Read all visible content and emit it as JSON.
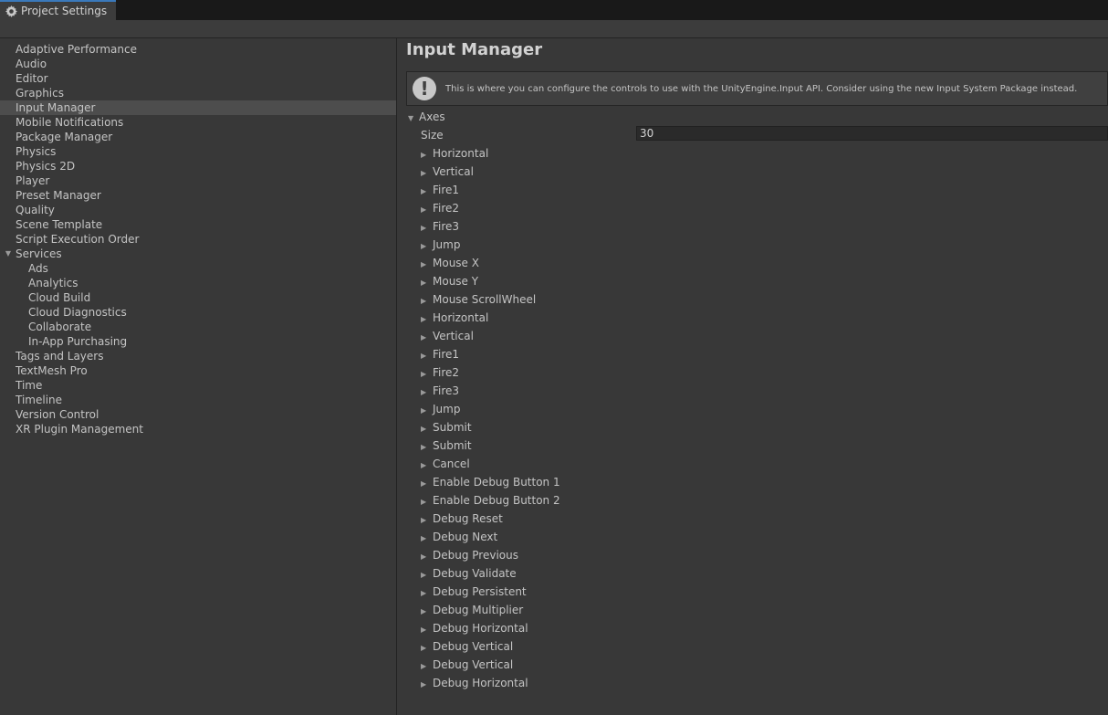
{
  "window": {
    "tab_title": "Project Settings",
    "tab_icon": "gear-icon"
  },
  "sidebar": {
    "items": [
      {
        "label": "Adaptive Performance"
      },
      {
        "label": "Audio"
      },
      {
        "label": "Editor"
      },
      {
        "label": "Graphics"
      },
      {
        "label": "Input Manager",
        "selected": true
      },
      {
        "label": "Mobile Notifications"
      },
      {
        "label": "Package Manager"
      },
      {
        "label": "Physics"
      },
      {
        "label": "Physics 2D"
      },
      {
        "label": "Player"
      },
      {
        "label": "Preset Manager"
      },
      {
        "label": "Quality"
      },
      {
        "label": "Scene Template"
      },
      {
        "label": "Script Execution Order"
      },
      {
        "label": "Services",
        "expanded": true
      },
      {
        "label": "Ads",
        "child": true
      },
      {
        "label": "Analytics",
        "child": true
      },
      {
        "label": "Cloud Build",
        "child": true
      },
      {
        "label": "Cloud Diagnostics",
        "child": true
      },
      {
        "label": "Collaborate",
        "child": true
      },
      {
        "label": "In-App Purchasing",
        "child": true
      },
      {
        "label": "Tags and Layers"
      },
      {
        "label": "TextMesh Pro"
      },
      {
        "label": "Time"
      },
      {
        "label": "Timeline"
      },
      {
        "label": "Version Control"
      },
      {
        "label": "XR Plugin Management"
      }
    ]
  },
  "main": {
    "title": "Input Manager",
    "help_text": "This is where you can configure the controls to use with the UnityEngine.Input API. Consider using the new Input System Package instead.",
    "help_icon": "warning-icon",
    "axes_label": "Axes",
    "size_label": "Size",
    "size_value": "30",
    "axes": [
      "Horizontal",
      "Vertical",
      "Fire1",
      "Fire2",
      "Fire3",
      "Jump",
      "Mouse X",
      "Mouse Y",
      "Mouse ScrollWheel",
      "Horizontal",
      "Vertical",
      "Fire1",
      "Fire2",
      "Fire3",
      "Jump",
      "Submit",
      "Submit",
      "Cancel",
      "Enable Debug Button 1",
      "Enable Debug Button 2",
      "Debug Reset",
      "Debug Next",
      "Debug Previous",
      "Debug Validate",
      "Debug Persistent",
      "Debug Multiplier",
      "Debug Horizontal",
      "Debug Vertical",
      "Debug Vertical",
      "Debug Horizontal"
    ]
  },
  "colors": {
    "accent": "#3a79bb",
    "background": "#383838",
    "selection": "#4d4d4d"
  }
}
